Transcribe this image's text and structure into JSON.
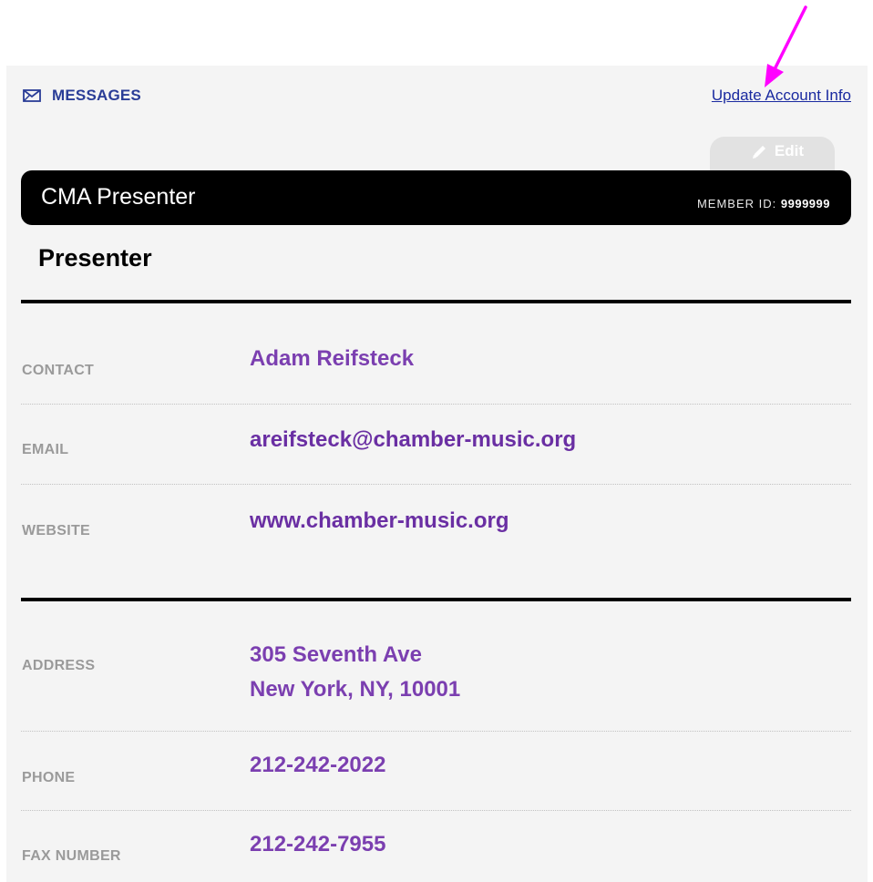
{
  "top_links": {
    "messages": "MESSAGES",
    "update_account": "Update Account Info"
  },
  "edit_tab": {
    "label": "Edit"
  },
  "header": {
    "name": "CMA Presenter",
    "member_id_label": "MEMBER ID:",
    "member_id": "9999999"
  },
  "member_type": "Presenter",
  "fields": {
    "contact": {
      "label": "CONTACT",
      "value": "Adam Reifsteck"
    },
    "email": {
      "label": "EMAIL",
      "value": "areifsteck@chamber-music.org"
    },
    "website": {
      "label": "WEBSITE",
      "value": "www.chamber-music.org"
    },
    "address": {
      "label": "ADDRESS",
      "line1": "305 Seventh Ave",
      "line2": "New York, NY, 10001"
    },
    "phone": {
      "label": "PHONE",
      "value": "212-242-2022"
    },
    "fax": {
      "label": "FAX NUMBER",
      "value": "212-242-7955"
    }
  },
  "colors": {
    "accent_value": "#7b3fb0",
    "link": "#2a3d97",
    "annotation_arrow": "#ff00ff",
    "header_bg": "#000000"
  },
  "icons": [
    "envelope-icon",
    "pencil-icon",
    "annotation-arrow-icon"
  ]
}
